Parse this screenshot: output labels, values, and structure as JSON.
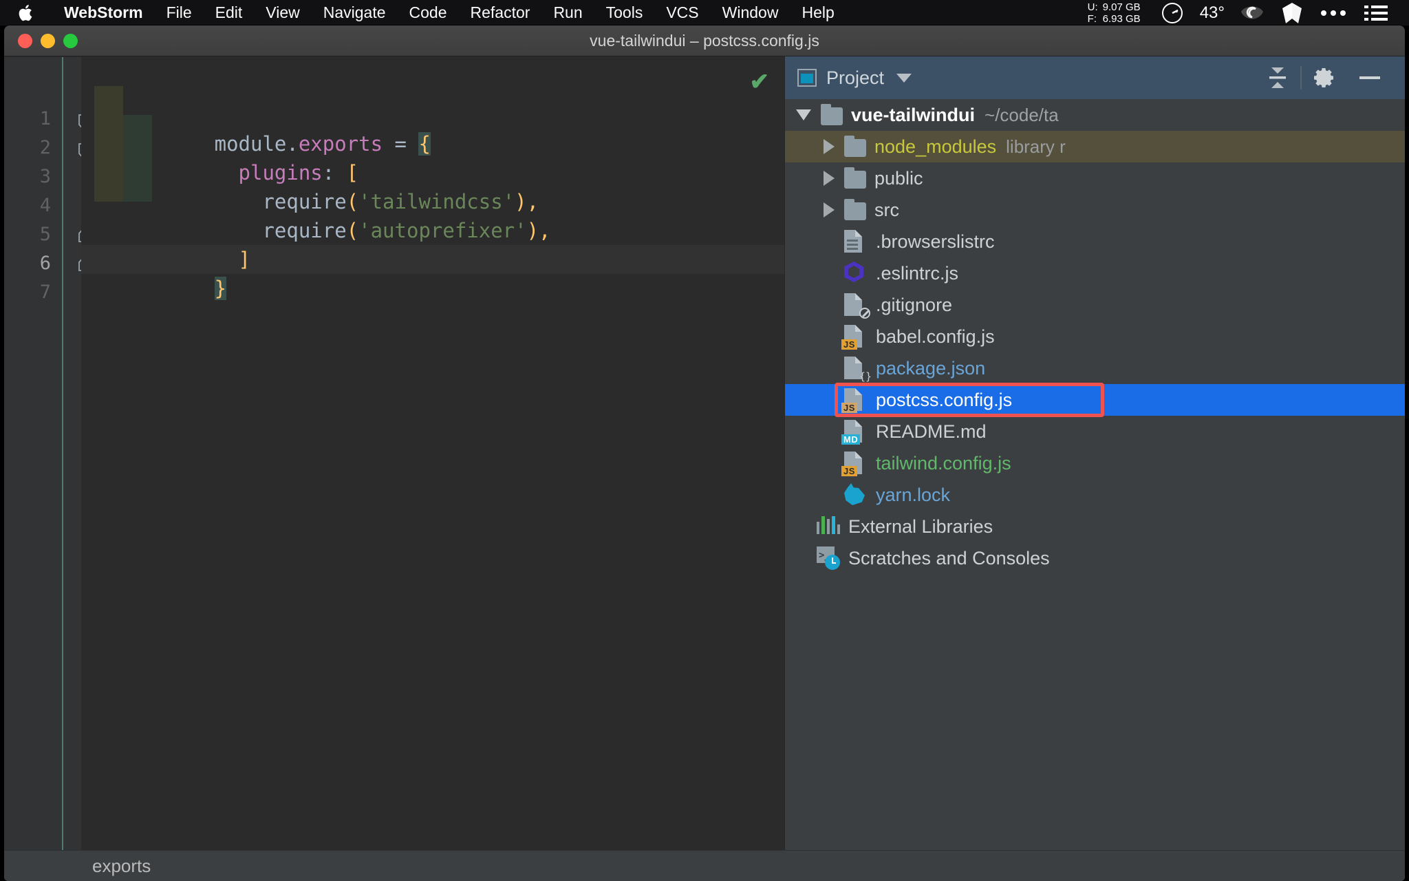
{
  "macbar": {
    "apple_icon": "apple-logo-icon",
    "menus": [
      {
        "label": "WebStorm",
        "bold": true
      },
      {
        "label": "File",
        "bold": false
      },
      {
        "label": "Edit",
        "bold": false
      },
      {
        "label": "View",
        "bold": false
      },
      {
        "label": "Navigate",
        "bold": false
      },
      {
        "label": "Code",
        "bold": false
      },
      {
        "label": "Refactor",
        "bold": false
      },
      {
        "label": "Run",
        "bold": false
      },
      {
        "label": "Tools",
        "bold": false
      },
      {
        "label": "VCS",
        "bold": false
      },
      {
        "label": "Window",
        "bold": false
      },
      {
        "label": "Help",
        "bold": false
      }
    ],
    "memory": {
      "used_label": "U:",
      "used_value": "9.07 GB",
      "free_label": "F:",
      "free_value": "6.93 GB"
    },
    "temperature": "43°",
    "icons": [
      "speedometer-icon",
      "eye-icon",
      "shield-icon",
      "ellipsis-icon",
      "control-center-icon"
    ]
  },
  "window": {
    "title": "vue-tailwindui – postcss.config.js",
    "traffic_lights": [
      "close-button",
      "minimize-button",
      "zoom-button"
    ]
  },
  "editor": {
    "inspection_status": "✔",
    "line_numbers": [
      "1",
      "2",
      "3",
      "4",
      "5",
      "6",
      "7"
    ],
    "current_line": 6,
    "lines": [
      {
        "n": 1,
        "tokens": [
          {
            "t": "module",
            "c": "tk-default"
          },
          {
            "t": ".",
            "c": "tk-punc"
          },
          {
            "t": "exports",
            "c": "tk-prop"
          },
          {
            "t": " = ",
            "c": "tk-default"
          },
          {
            "t": "{",
            "c": "tk-brace-hl"
          }
        ]
      },
      {
        "n": 2,
        "tokens": [
          {
            "t": "  ",
            "c": "tk-default"
          },
          {
            "t": "plugins",
            "c": "tk-prop"
          },
          {
            "t": ": ",
            "c": "tk-default"
          },
          {
            "t": "[",
            "c": "tk-brace"
          }
        ]
      },
      {
        "n": 3,
        "tokens": [
          {
            "t": "    require",
            "c": "tk-default"
          },
          {
            "t": "(",
            "c": "tk-brace"
          },
          {
            "t": "'tailwindcss'",
            "c": "tk-string"
          },
          {
            "t": ")",
            "c": "tk-brace"
          },
          {
            "t": ",",
            "c": "tk-brace"
          }
        ]
      },
      {
        "n": 4,
        "tokens": [
          {
            "t": "    require",
            "c": "tk-default"
          },
          {
            "t": "(",
            "c": "tk-brace"
          },
          {
            "t": "'autoprefixer'",
            "c": "tk-string"
          },
          {
            "t": ")",
            "c": "tk-brace"
          },
          {
            "t": ",",
            "c": "tk-brace"
          }
        ]
      },
      {
        "n": 5,
        "tokens": [
          {
            "t": "  ",
            "c": "tk-default"
          },
          {
            "t": "]",
            "c": "tk-brace"
          }
        ]
      },
      {
        "n": 6,
        "tokens": [
          {
            "t": "}",
            "c": "tk-brace-hl"
          }
        ]
      },
      {
        "n": 7,
        "tokens": []
      }
    ],
    "fold_markers": [
      {
        "line": 1,
        "type": "collapse-expanded-icon"
      },
      {
        "line": 2,
        "type": "collapse-expanded-icon"
      },
      {
        "line": 5,
        "type": "fold-end-icon"
      },
      {
        "line": 6,
        "type": "fold-end-icon"
      }
    ]
  },
  "project_panel": {
    "header": {
      "icon": "project-window-icon",
      "title": "Project",
      "dropdown": "chevron-down-icon",
      "collapse_all": "collapse-all-icon",
      "settings": "gear-icon",
      "hide": "minimize-icon"
    },
    "tree": [
      {
        "label": "vue-tailwindui",
        "sub": "~/code/ta",
        "icon": "folder-icon",
        "arrow": "down",
        "indent": 0,
        "style": "root",
        "state": "normal"
      },
      {
        "label": "node_modules",
        "sub": "library r",
        "icon": "folder-icon",
        "arrow": "right",
        "indent": 1,
        "style": "library",
        "state": "normal"
      },
      {
        "label": "public",
        "sub": "",
        "icon": "folder-icon",
        "arrow": "right",
        "indent": 1,
        "style": "plain",
        "state": "normal"
      },
      {
        "label": "src",
        "sub": "",
        "icon": "folder-icon",
        "arrow": "right",
        "indent": 1,
        "style": "plain",
        "state": "normal"
      },
      {
        "label": ".browserslistrc",
        "sub": "",
        "icon": "text-file-icon",
        "arrow": "none",
        "indent": 1,
        "style": "plain",
        "state": "normal"
      },
      {
        "label": ".eslintrc.js",
        "sub": "",
        "icon": "eslint-icon",
        "arrow": "none",
        "indent": 1,
        "style": "plain",
        "state": "normal"
      },
      {
        "label": ".gitignore",
        "sub": "",
        "icon": "gitignore-file-icon",
        "arrow": "none",
        "indent": 1,
        "style": "plain",
        "state": "normal"
      },
      {
        "label": "babel.config.js",
        "sub": "",
        "icon": "js-file-icon",
        "arrow": "none",
        "indent": 1,
        "style": "plain",
        "state": "normal"
      },
      {
        "label": "package.json",
        "sub": "",
        "icon": "json-file-icon",
        "arrow": "none",
        "indent": 1,
        "style": "json",
        "state": "normal"
      },
      {
        "label": "postcss.config.js",
        "sub": "",
        "icon": "js-file-icon",
        "arrow": "none",
        "indent": 1,
        "style": "plain",
        "state": "selected"
      },
      {
        "label": "README.md",
        "sub": "",
        "icon": "md-file-icon",
        "arrow": "none",
        "indent": 1,
        "style": "plain",
        "state": "normal"
      },
      {
        "label": "tailwind.config.js",
        "sub": "",
        "icon": "js-file-icon",
        "arrow": "none",
        "indent": 1,
        "style": "green",
        "state": "normal"
      },
      {
        "label": "yarn.lock",
        "sub": "",
        "icon": "yarn-file-icon",
        "arrow": "none",
        "indent": 1,
        "style": "json",
        "state": "normal"
      },
      {
        "label": "External Libraries",
        "sub": "",
        "icon": "external-libraries-icon",
        "arrow": "none",
        "indent": 0,
        "style": "plain",
        "state": "normal"
      },
      {
        "label": "Scratches and Consoles",
        "sub": "",
        "icon": "scratches-icon",
        "arrow": "none",
        "indent": 0,
        "style": "plain",
        "state": "normal"
      }
    ],
    "selection_highlight_color": "#1a6ce7",
    "annotation_outline_color": "#f0534f"
  },
  "statusbar": {
    "breadcrumb": "exports"
  }
}
